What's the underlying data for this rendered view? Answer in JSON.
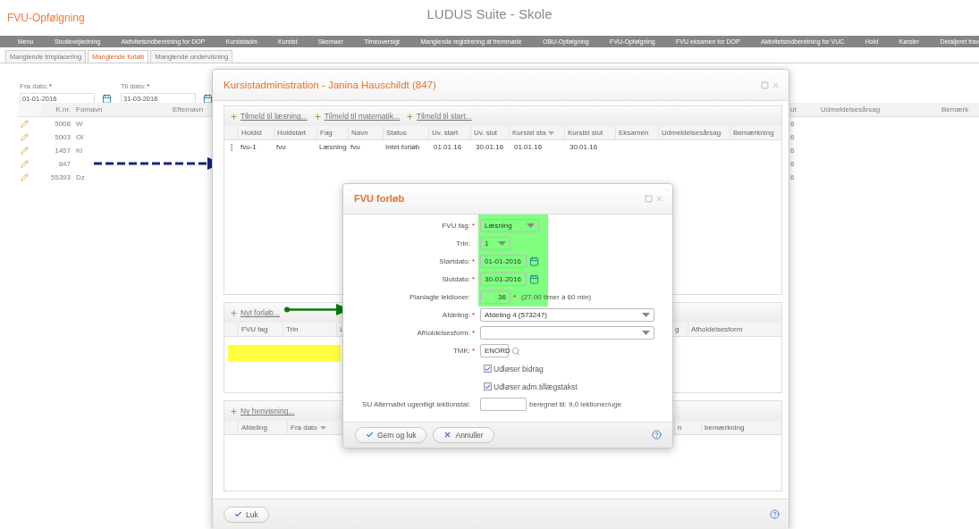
{
  "app": {
    "title": "FVU-Opfølgning",
    "suite": "LUDUS Suite - Skole"
  },
  "menu": [
    "Menu",
    "Studievejledning",
    "Aktivitetsindberetning for DOP",
    "Kursistadm",
    "Kursist",
    "Skemaer",
    "Timeoversigt",
    "Manglende registrering af fremmøde",
    "OBU-Opfølgning",
    "FVU-Opfølgning",
    "FVU eksamen for DOP",
    "Aktivitetsindberetning for VUC",
    "Hold",
    "Kørsler",
    "Detaljeret frav"
  ],
  "tabs": [
    {
      "label": "Manglende trinplacering",
      "selected": false
    },
    {
      "label": "Manglende forløb",
      "selected": true
    },
    {
      "label": "Manglende undervisning",
      "selected": false
    }
  ],
  "filters": [
    {
      "label": "Fra dato:",
      "required_mark": "*",
      "value": "01-01-2016"
    },
    {
      "label": "Til dato:",
      "required_mark": "*",
      "value": "31-03-2016"
    }
  ],
  "list": {
    "columns": [
      "K.nr.",
      "Fornavn",
      "Efternavn",
      "ut",
      "Udmeldelsesårsag",
      "Bemærk"
    ],
    "rows": [
      {
        "knr": "5008",
        "first_name": "W",
        "column_4": "6"
      },
      {
        "knr": "5003",
        "first_name": "Ol",
        "column_4": "6"
      },
      {
        "knr": "1457",
        "first_name": "Ki",
        "column_4": "6"
      },
      {
        "knr": "847",
        "column_4": "6"
      },
      {
        "knr": "55393",
        "first_name": "Dz",
        "column_4": "6"
      }
    ]
  },
  "kursist_dialog": {
    "title": "Kursistadministration - Janina Hauschildt (847)",
    "enrollment_panel": {
      "links": [
        "Tilmeld til læsning...",
        "Tilmeld til matematik...",
        "Tilmeld til start..."
      ],
      "columns": [
        {
          "label": "Holdid",
          "sorted": false
        },
        {
          "label": "Holdstart",
          "sorted": false
        },
        {
          "label": "Fag",
          "sorted": false
        },
        {
          "label": "Navn",
          "sorted": false
        },
        {
          "label": "Status",
          "sorted": false
        },
        {
          "label": "Uv. start",
          "sorted": false
        },
        {
          "label": "Uv. slut",
          "sorted": false
        },
        {
          "label": "Kursist sta",
          "sorted": true
        },
        {
          "label": "Kursist slut",
          "sorted": false
        },
        {
          "label": "Eksamen",
          "sorted": false
        },
        {
          "label": "Udmeldelsesårsag",
          "sorted": false
        },
        {
          "label": "Bemærkning",
          "sorted": false
        }
      ],
      "rows": [
        [
          "fvu-1",
          "fvu",
          "Læsning",
          "fvu",
          "Intet forløb",
          "01.01.16",
          "30.01.16",
          "01.01.16",
          "30.01.16"
        ]
      ]
    },
    "course_panel": {
      "link": "Nyt forløb...",
      "columns": [
        {
          "label": "FVU fag"
        },
        {
          "label": "Trin"
        },
        {
          "label": "L"
        },
        {
          "label": "g"
        },
        {
          "label": "Afholdelsesform"
        }
      ]
    },
    "referral_panel": {
      "link": "Ny henvisning...",
      "columns": [
        {
          "label": "Afdeling",
          "sorted": false
        },
        {
          "label": "Fra dato",
          "sorted": true
        },
        {
          "label": "n",
          "sorted": false
        },
        {
          "label": "bemærkning",
          "sorted": false
        }
      ]
    },
    "close_button": "Luk"
  },
  "fvu_dialog": {
    "title": "FVU forløb",
    "fields": [
      {
        "kind": "select",
        "label": "FVU fag:",
        "required_mark": "*",
        "value": "Læsning"
      },
      {
        "kind": "small-select",
        "label": "Trin:",
        "value": "1"
      },
      {
        "kind": "date",
        "label": "Startdato:",
        "required_mark": "*",
        "value": "01-01-2016"
      },
      {
        "kind": "date",
        "label": "Slutdato:",
        "required_mark": "*",
        "value": "30-01-2016"
      },
      {
        "kind": "number",
        "label": "Planlagte lektioner:",
        "value": "36",
        "after_mark": "*",
        "note": "(27,00 timer à 60 min)"
      },
      {
        "kind": "wide-select",
        "label": "Afdeling:",
        "required_mark": "*",
        "value": "Afdeling 4 (573247)"
      },
      {
        "kind": "wide-select",
        "label": "Afholdelsesform:",
        "required_mark": "*"
      },
      {
        "kind": "lookup",
        "label": "TMK:",
        "required_mark": "*",
        "value": "ENORD"
      },
      {
        "kind": "checkbox",
        "label": "Udløser bidrag",
        "checked": true
      },
      {
        "kind": "checkbox",
        "label": "Udløser adm.tillægstakst",
        "checked": true
      },
      {
        "kind": "text",
        "label": "SU Alternativt ugentligt lektionstal:",
        "note": "beregnet til: 9,0 lektioner/uge"
      }
    ],
    "buttons": [
      {
        "kind": "save",
        "label": "Gem og luk"
      },
      {
        "kind": "cancel",
        "label": "Annuller"
      }
    ]
  }
}
